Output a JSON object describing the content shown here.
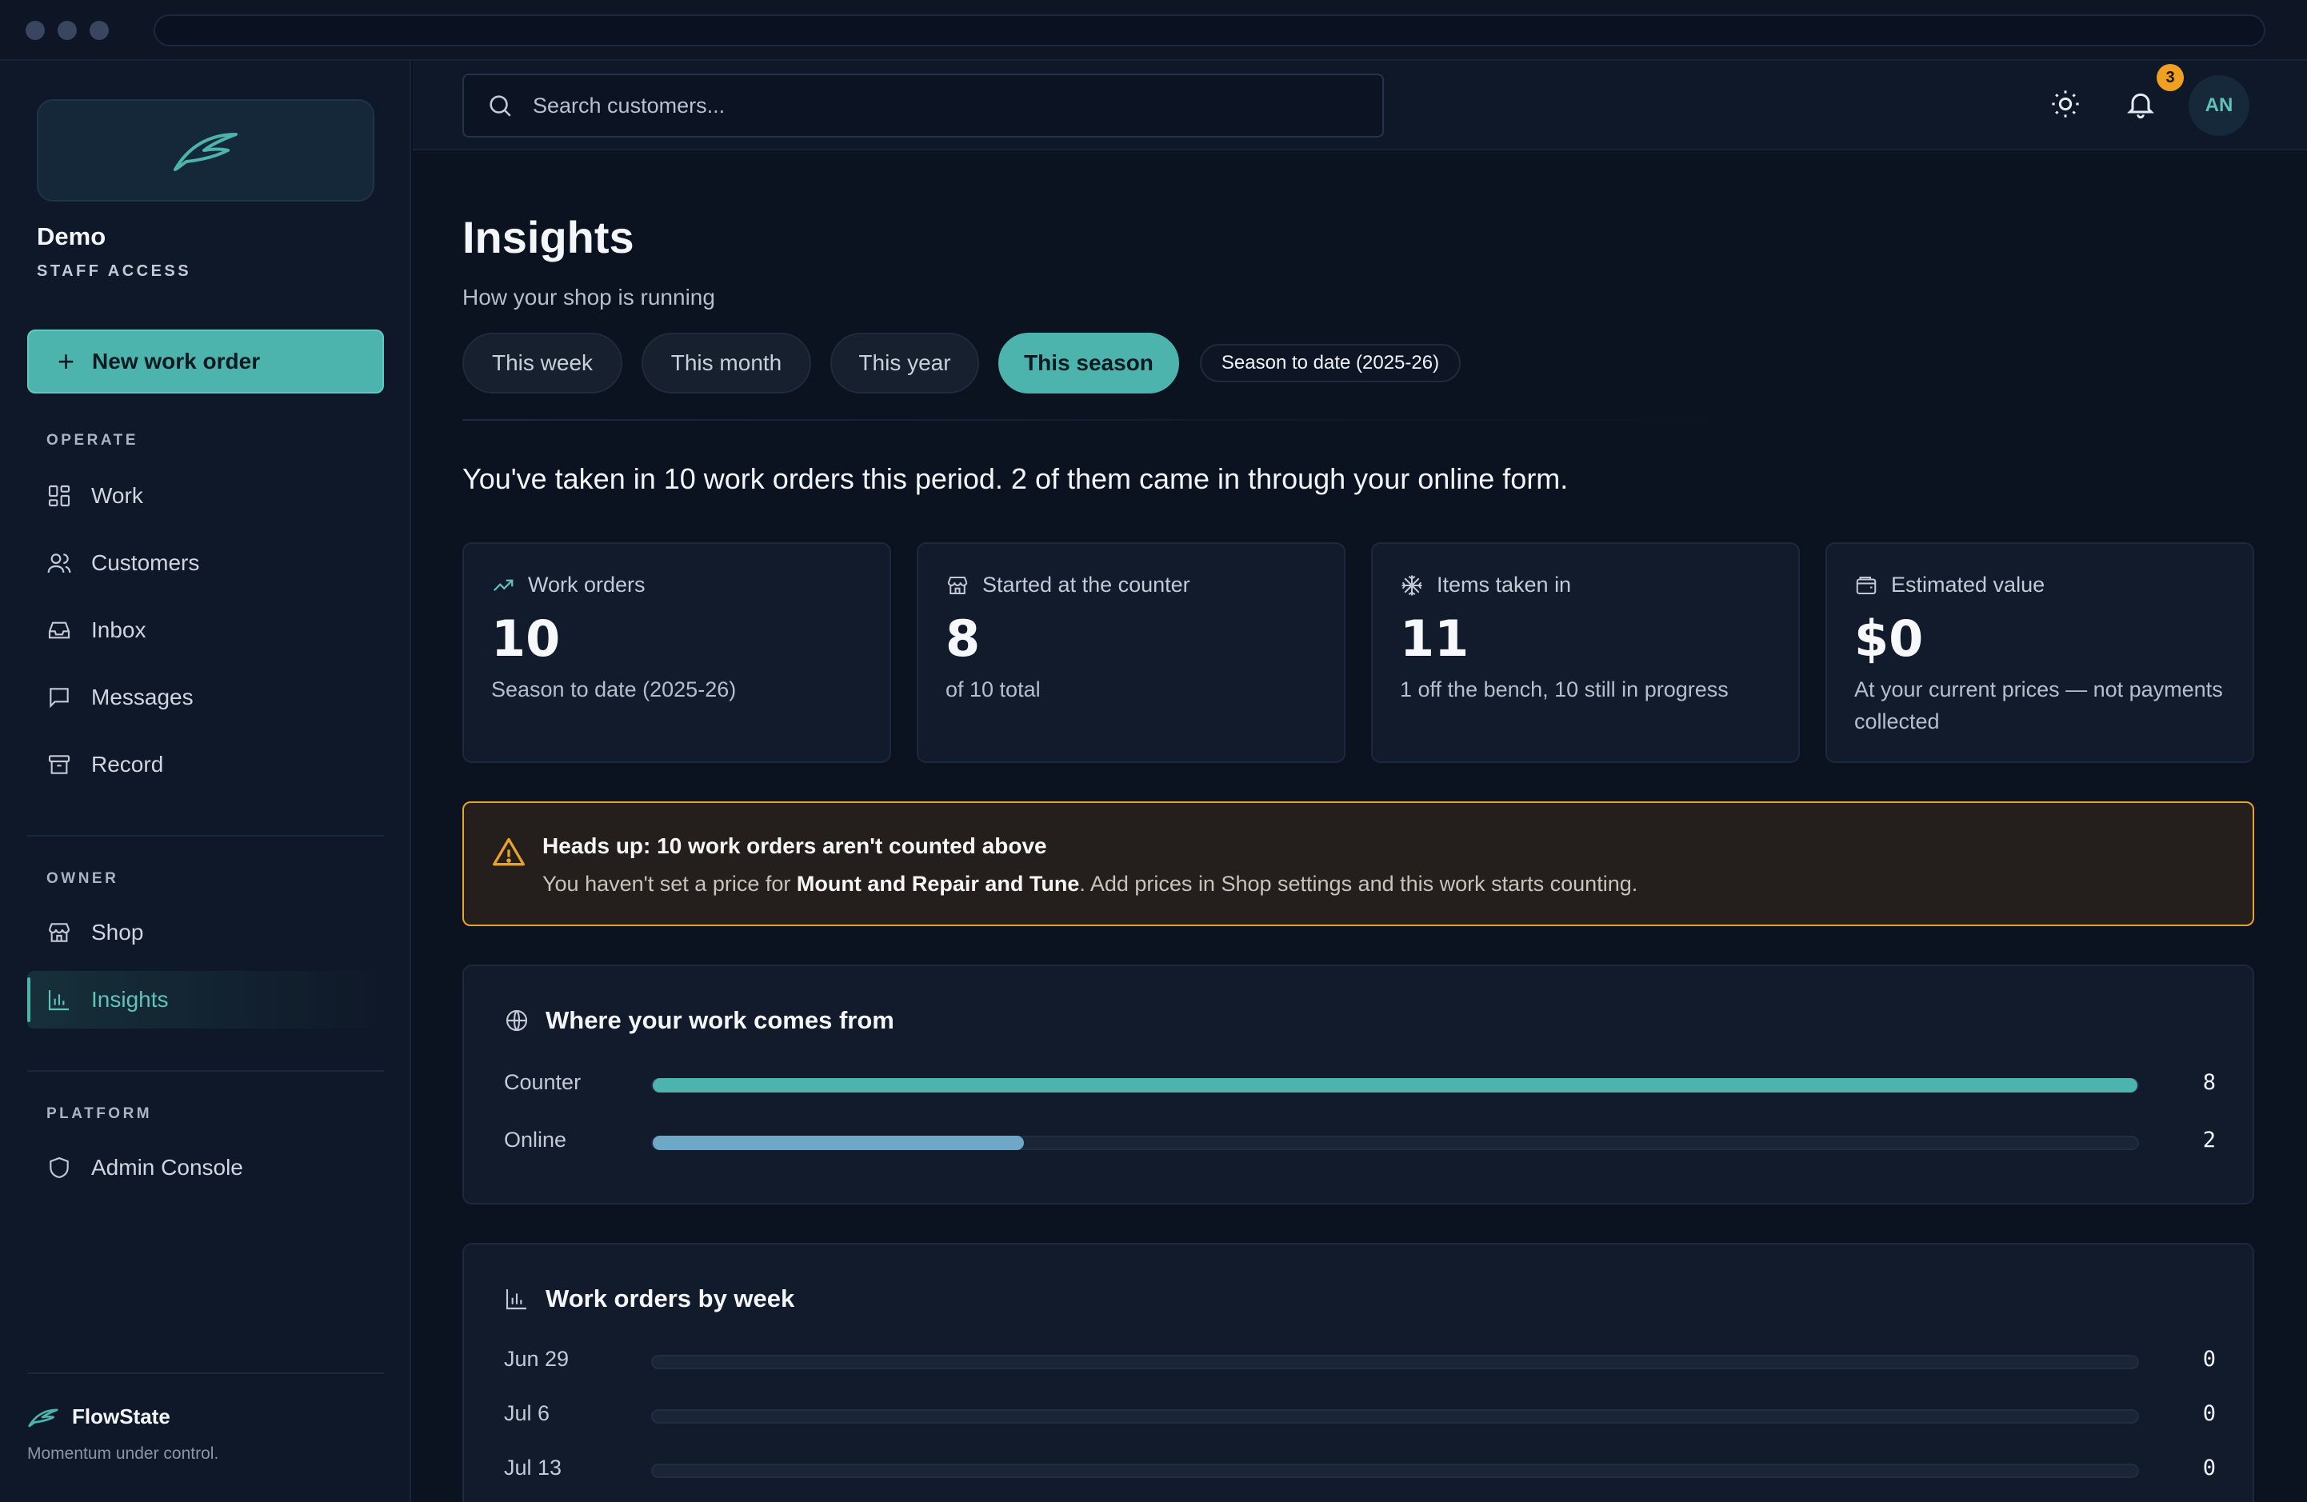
{
  "sidebar": {
    "org_name": "Demo",
    "org_sub": "STAFF ACCESS",
    "new_button": "New work order",
    "sections": {
      "operate": "OPERATE",
      "owner": "OWNER",
      "platform": "PLATFORM"
    },
    "items": [
      {
        "label": "Work",
        "icon": "grid-icon"
      },
      {
        "label": "Customers",
        "icon": "users-icon"
      },
      {
        "label": "Inbox",
        "icon": "inbox-icon"
      },
      {
        "label": "Messages",
        "icon": "message-icon"
      },
      {
        "label": "Record",
        "icon": "archive-icon"
      },
      {
        "label": "Shop",
        "icon": "store-icon"
      },
      {
        "label": "Insights",
        "icon": "bar-chart-icon",
        "active": true
      },
      {
        "label": "Admin Console",
        "icon": "shield-icon"
      }
    ],
    "brand_name": "FlowState",
    "brand_tagline": "Momentum under control."
  },
  "header": {
    "search_placeholder": "Search customers...",
    "notifications_count": "3",
    "avatar_initials": "AN"
  },
  "main": {
    "title": "Insights",
    "subtitle": "How your shop is running",
    "periods": [
      "This week",
      "This month",
      "This year",
      "This season"
    ],
    "active_period": "This season",
    "range_label": "Season to date (2025-26)",
    "summary": "You've taken in 10 work orders this period. 2 of them came in through your online form.",
    "stats": [
      {
        "label": "Work orders",
        "value": "10",
        "note": "Season to date (2025-26)",
        "icon": "trending-up-icon"
      },
      {
        "label": "Started at the counter",
        "value": "8",
        "note": "of 10 total",
        "icon": "store-icon"
      },
      {
        "label": "Items taken in",
        "value": "11",
        "note": "1 off the bench, 10 still in progress",
        "icon": "snowflake-icon"
      },
      {
        "label": "Estimated value",
        "value": "$0",
        "note": "At your current prices — not payments collected",
        "icon": "wallet-icon"
      }
    ],
    "alert": {
      "title": "Heads up: 10 work orders aren't counted above",
      "body_prefix": "You haven't set a price for ",
      "body_bold": "Mount and Repair and Tune",
      "body_suffix": ". Add prices in Shop settings and this work starts counting."
    },
    "sources": {
      "title": "Where your work comes from",
      "rows": [
        {
          "label": "Counter",
          "value": 8,
          "display": "8",
          "fraction": 1.0,
          "color": "#4db3ad"
        },
        {
          "label": "Online",
          "value": 2,
          "display": "2",
          "fraction": 0.25,
          "color": "#6fa8c6"
        }
      ]
    },
    "weekly": {
      "title": "Work orders by week",
      "rows": [
        {
          "label": "Jun 29",
          "value": 0,
          "display": "0"
        },
        {
          "label": "Jul 6",
          "value": 0,
          "display": "0"
        },
        {
          "label": "Jul 13",
          "value": 0,
          "display": "0"
        }
      ]
    }
  },
  "colors": {
    "accent": "#4db3ad",
    "warning": "#e8a32a",
    "background": "#0b1220"
  }
}
